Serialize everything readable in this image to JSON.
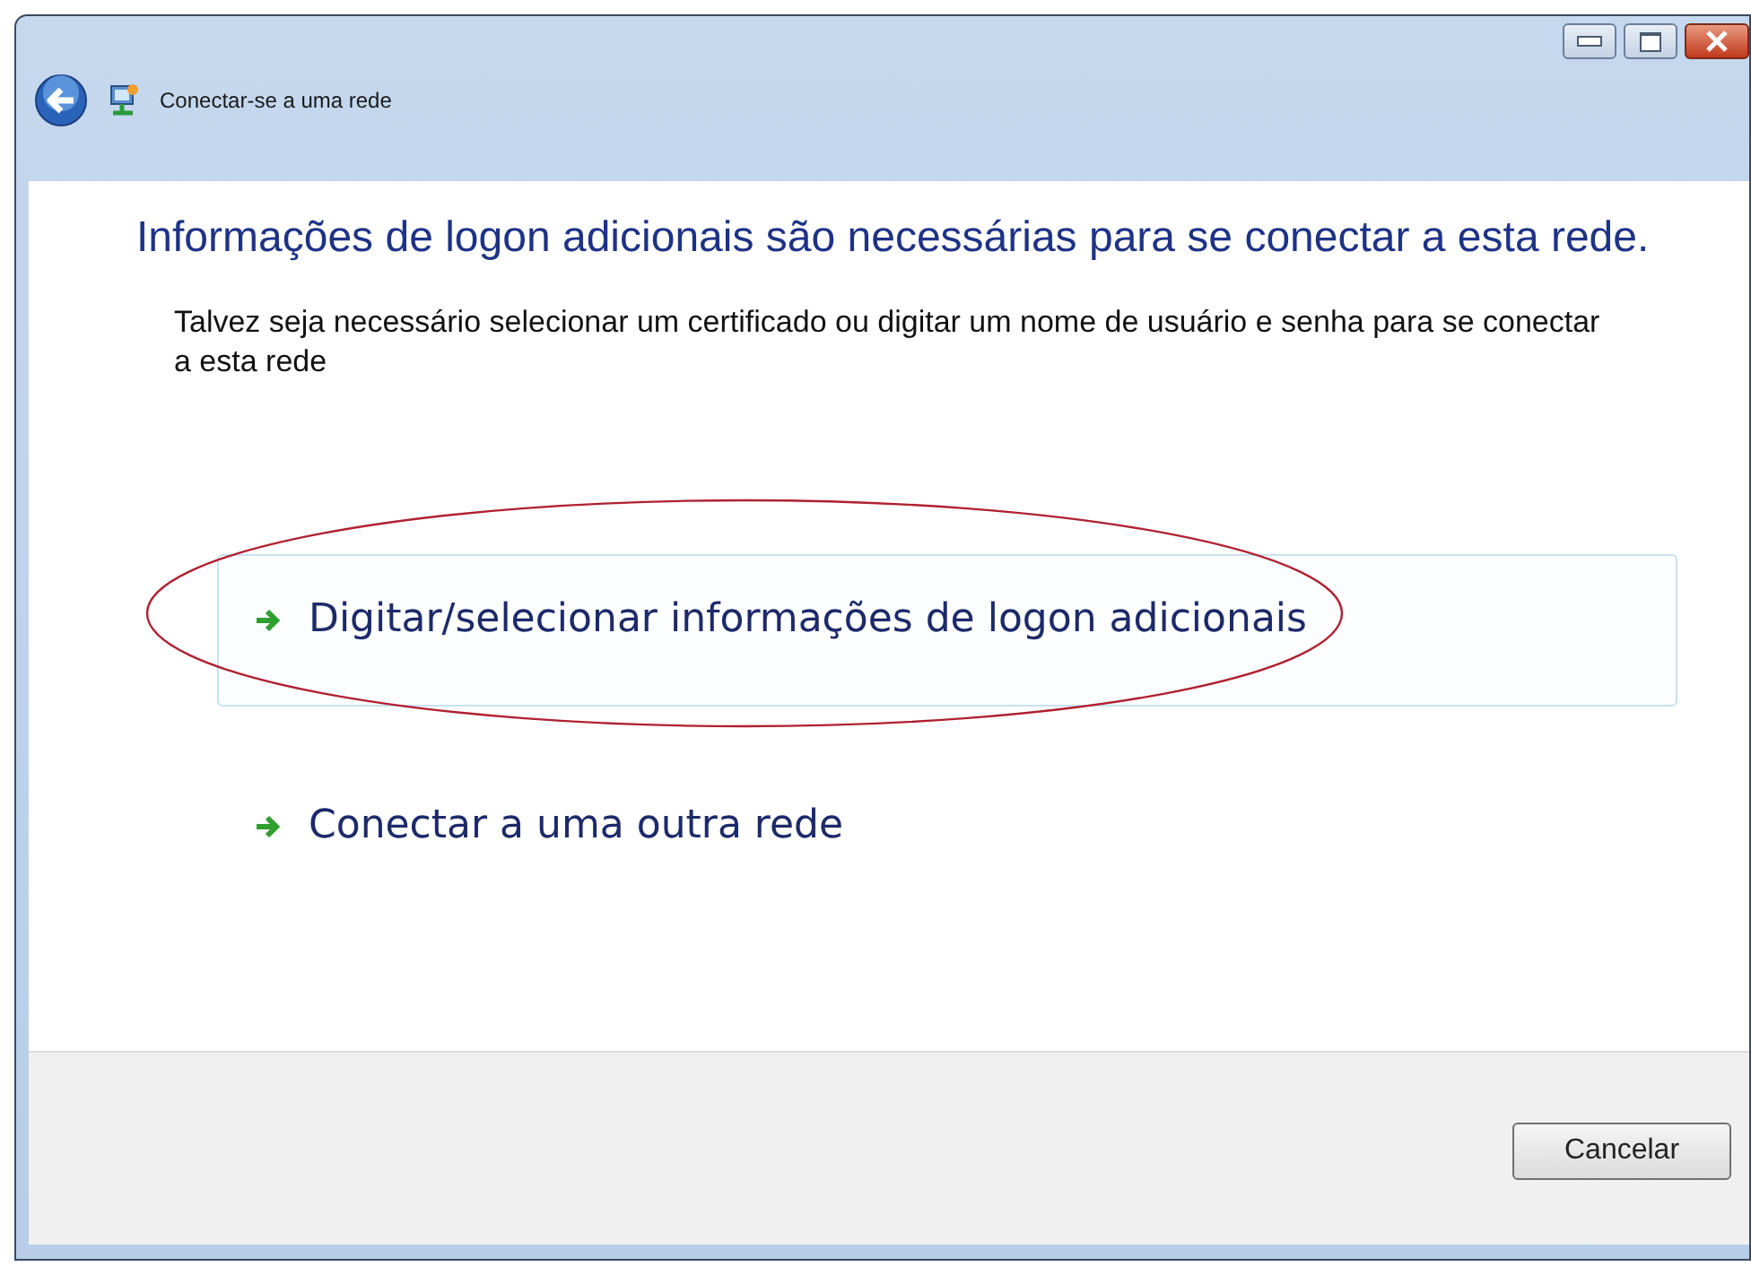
{
  "window": {
    "title": "Conectar-se a uma rede",
    "controls": [
      {
        "kind": "minimize"
      },
      {
        "kind": "maximize"
      },
      {
        "kind": "close"
      }
    ]
  },
  "heading": "Informações de logon adicionais são necessárias para se conectar a esta rede.",
  "description": "Talvez seja necessário selecionar um certificado ou digitar um nome de usuário e senha para se conectar a esta rede",
  "options": [
    {
      "label": "Digitar/selecionar informações de logon adicionais",
      "selected": true,
      "circled": true
    },
    {
      "label": "Conectar a uma outra rede",
      "selected": false,
      "circled": false
    }
  ],
  "buttons": [
    "Cancelar"
  ]
}
